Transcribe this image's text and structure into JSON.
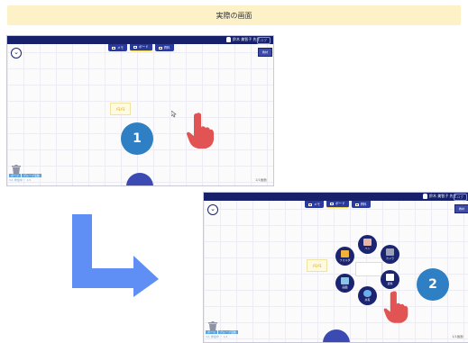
{
  "header": {
    "title": "実際の画面"
  },
  "screen1": {
    "tabs": [
      "メモ",
      "ボード",
      "資料"
    ],
    "user": "鈴木 美智子 先生",
    "logout": "ログ",
    "top_right": "教材",
    "note_text": "ﾒﾓﾒﾓ",
    "status_chip1": "ボード",
    "status_chip2": "グループ活動",
    "status_sub": "3人 参加中 ・ 1/1",
    "page_counter": "1/1画面",
    "badge": "1"
  },
  "screen2": {
    "tabs": [
      "メモ",
      "ボード",
      "資料"
    ],
    "user": "鈴木 美智子 先生",
    "logout": "ログ",
    "top_right": "教材",
    "note_text": "ﾒﾓﾒﾓ",
    "status_chip1": "ボード",
    "status_chip2": "グループ活動",
    "status_sub": "3人 参加中 ・ 1/1",
    "page_counter": "1/1画面",
    "badge": "2",
    "ring": [
      {
        "label": "ペン",
        "icon_color": "#e7b7a6"
      },
      {
        "label": "カメラ",
        "icon_color": "#9aa0b8"
      },
      {
        "label": "資料",
        "icon_color": "#ffffff"
      },
      {
        "label": "共有",
        "icon_color": "#6bb0e8"
      },
      {
        "label": "画面",
        "icon_color": "#8cc4e8"
      },
      {
        "label": "フォルダ",
        "icon_color": "#f0b33a"
      }
    ]
  },
  "colors": {
    "accent": "#2e7fc3",
    "arrow": "#5f8ff5",
    "hand": "#e25454",
    "navy": "#17206a"
  }
}
